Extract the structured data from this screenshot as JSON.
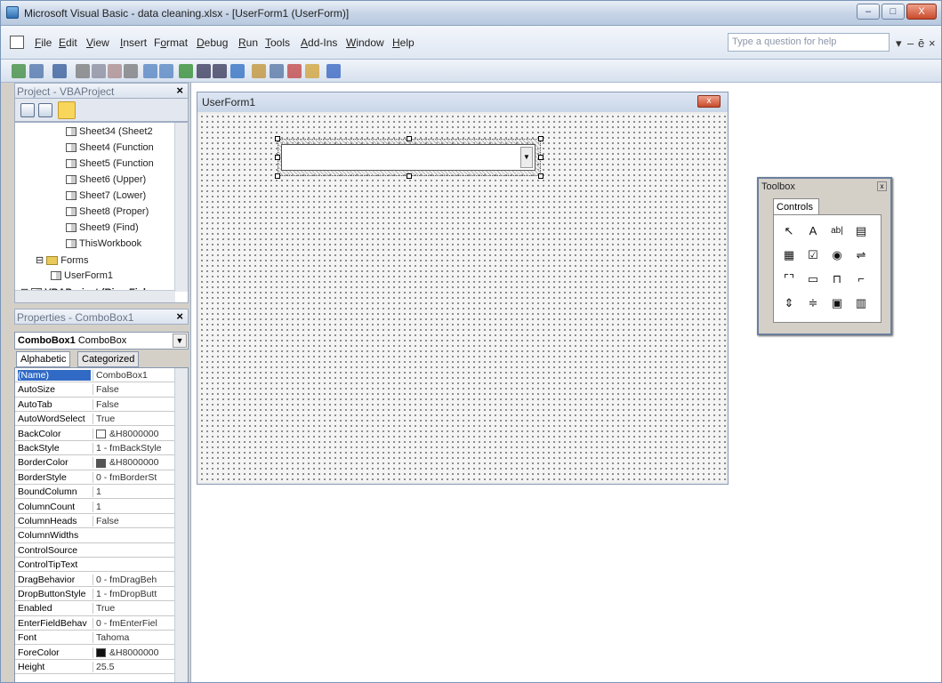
{
  "window": {
    "title": "Microsoft Visual Basic - data cleaning.xlsx - [UserForm1 (UserForm)]"
  },
  "window_controls": {
    "minimize": "–",
    "maximize": "□",
    "close": "X"
  },
  "menus": [
    {
      "label": "File",
      "u": "F"
    },
    {
      "label": "Edit",
      "u": "E"
    },
    {
      "label": "View",
      "u": "V"
    },
    {
      "label": "Insert",
      "u": "I"
    },
    {
      "label": "Format",
      "u": "o"
    },
    {
      "label": "Debug",
      "u": "D"
    },
    {
      "label": "Run",
      "u": "R"
    },
    {
      "label": "Tools",
      "u": "T"
    },
    {
      "label": "Add-Ins",
      "u": "A"
    },
    {
      "label": "Window",
      "u": "W"
    },
    {
      "label": "Help",
      "u": "H"
    }
  ],
  "help_box": {
    "placeholder": "Type a question for help"
  },
  "mdi_controls": {
    "dropdown": "▾",
    "minimize": "–",
    "restore": "ē",
    "close": "×"
  },
  "project_pane": {
    "title": "Project - VBAProject",
    "close": "×",
    "items": [
      {
        "label": "Sheet34 (Sheet2",
        "type": "sheet",
        "indent": 3
      },
      {
        "label": "Sheet4 (Function",
        "type": "sheet",
        "indent": 3
      },
      {
        "label": "Sheet5 (Function",
        "type": "sheet",
        "indent": 3
      },
      {
        "label": "Sheet6 (Upper)",
        "type": "sheet",
        "indent": 3
      },
      {
        "label": "Sheet7 (Lower)",
        "type": "sheet",
        "indent": 3
      },
      {
        "label": "Sheet8 (Proper)",
        "type": "sheet",
        "indent": 3
      },
      {
        "label": "Sheet9 (Find)",
        "type": "sheet",
        "indent": 3
      },
      {
        "label": "ThisWorkbook",
        "type": "workbook",
        "indent": 3
      },
      {
        "label": "Forms",
        "type": "folder",
        "indent": 1,
        "expander": "⊟"
      },
      {
        "label": "UserForm1",
        "type": "form",
        "indent": 2
      },
      {
        "label": "VBAProject (RiverFiel",
        "type": "project",
        "indent": 0,
        "expander": "⊞"
      }
    ]
  },
  "properties_pane": {
    "title": "Properties - ComboBox1",
    "close": "×",
    "object_name": "ComboBox1",
    "object_type": "ComboBox",
    "tabs": [
      "Alphabetic",
      "Categorized"
    ],
    "rows": [
      {
        "name": "(Name)",
        "value": "ComboBox1",
        "selected": true
      },
      {
        "name": "AutoSize",
        "value": "False"
      },
      {
        "name": "AutoTab",
        "value": "False"
      },
      {
        "name": "AutoWordSelect",
        "value": "True"
      },
      {
        "name": "BackColor",
        "value": "&H8000000",
        "swatch": "#ffffff"
      },
      {
        "name": "BackStyle",
        "value": "1 - fmBackStyle"
      },
      {
        "name": "BorderColor",
        "value": "&H8000000",
        "swatch": "#555555"
      },
      {
        "name": "BorderStyle",
        "value": "0 - fmBorderSt"
      },
      {
        "name": "BoundColumn",
        "value": "1"
      },
      {
        "name": "ColumnCount",
        "value": "1"
      },
      {
        "name": "ColumnHeads",
        "value": "False"
      },
      {
        "name": "ColumnWidths",
        "value": ""
      },
      {
        "name": "ControlSource",
        "value": ""
      },
      {
        "name": "ControlTipText",
        "value": ""
      },
      {
        "name": "DragBehavior",
        "value": "0 - fmDragBeh"
      },
      {
        "name": "DropButtonStyle",
        "value": "1 - fmDropButt"
      },
      {
        "name": "Enabled",
        "value": "True"
      },
      {
        "name": "EnterFieldBehav",
        "value": "0 - fmEnterFiel"
      },
      {
        "name": "Font",
        "value": "Tahoma"
      },
      {
        "name": "ForeColor",
        "value": "&H8000000",
        "swatch": "#111111"
      },
      {
        "name": "Height",
        "value": "25.5"
      }
    ]
  },
  "userform": {
    "title": "UserForm1",
    "close": "x"
  },
  "toolbox": {
    "title": "Toolbox",
    "close": "x",
    "tab": "Controls",
    "tools": [
      {
        "name": "select-objects-tool",
        "glyph": "↖"
      },
      {
        "name": "label-tool",
        "glyph": "A"
      },
      {
        "name": "textbox-tool",
        "glyph": "ab|"
      },
      {
        "name": "combobox-tool",
        "glyph": "▤"
      },
      {
        "name": "listbox-tool",
        "glyph": "▦"
      },
      {
        "name": "checkbox-tool",
        "glyph": "☑"
      },
      {
        "name": "optionbutton-tool",
        "glyph": "◉"
      },
      {
        "name": "togglebutton-tool",
        "glyph": "⇌"
      },
      {
        "name": "frame-tool",
        "glyph": "⌜⌝"
      },
      {
        "name": "commandbutton-tool",
        "glyph": "▭"
      },
      {
        "name": "tabstrip-tool",
        "glyph": "⊓"
      },
      {
        "name": "multipage-tool",
        "glyph": "⌐"
      },
      {
        "name": "scrollbar-tool",
        "glyph": "⇕"
      },
      {
        "name": "spinbutton-tool",
        "glyph": "≑"
      },
      {
        "name": "image-tool",
        "glyph": "▣"
      },
      {
        "name": "refedit-tool",
        "glyph": "▥"
      }
    ]
  }
}
